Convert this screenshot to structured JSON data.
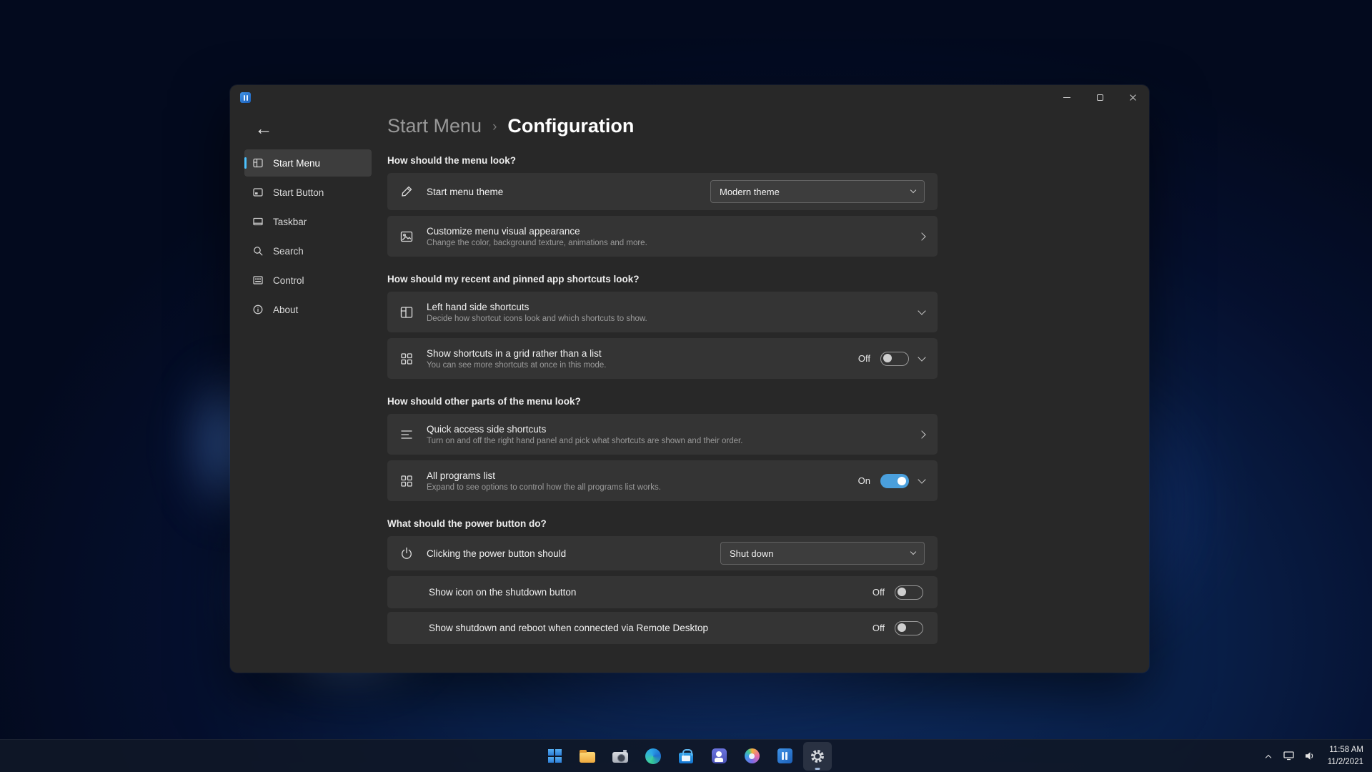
{
  "colors": {
    "accent": "#4cc2ff",
    "toggle_on": "#4a9fdc",
    "window_bg": "#282828",
    "card_bg": "#343434"
  },
  "icons": {
    "back_arrow": "←"
  },
  "breadcrumb": {
    "parent": "Start Menu",
    "separator": "›",
    "current": "Configuration"
  },
  "sidebar": {
    "items": [
      {
        "label": "Start Menu",
        "icon": "start-menu-icon",
        "active": true
      },
      {
        "label": "Start Button",
        "icon": "start-button-icon",
        "active": false
      },
      {
        "label": "Taskbar",
        "icon": "taskbar-icon",
        "active": false
      },
      {
        "label": "Search",
        "icon": "search-icon",
        "active": false
      },
      {
        "label": "Control",
        "icon": "control-icon",
        "active": false
      },
      {
        "label": "About",
        "icon": "about-icon",
        "active": false
      }
    ]
  },
  "headers": {
    "look": "How should the menu look?",
    "shortcuts": "How should my recent and pinned app shortcuts look?",
    "other": "How should other parts of the menu look?",
    "power": "What should the power button do?"
  },
  "rows": {
    "theme": {
      "icon": "pencil-icon",
      "title": "Start menu theme",
      "value": "Modern theme"
    },
    "customize": {
      "icon": "image-icon",
      "title": "Customize menu visual appearance",
      "subtitle": "Change the color, background texture, animations and more."
    },
    "leftside": {
      "icon": "layout-icon",
      "title": "Left hand side shortcuts",
      "subtitle": "Decide how shortcut icons look and which shortcuts to show."
    },
    "gridmode": {
      "icon": "grid-icon",
      "title": "Show shortcuts in a grid rather than a list",
      "subtitle": "You can see more shortcuts at once in this mode.",
      "state": "Off"
    },
    "quickaccess": {
      "icon": "list-icon",
      "title": "Quick access side shortcuts",
      "subtitle": "Turn on and off the right hand panel and pick what shortcuts are shown and their order."
    },
    "allprograms": {
      "icon": "grid-icon",
      "title": "All programs list",
      "subtitle": "Expand to see options to control how the all programs list works.",
      "state": "On"
    },
    "powerbutton": {
      "icon": "power-icon",
      "title": "Clicking the power button should",
      "value": "Shut down"
    },
    "shutdownicon": {
      "title": "Show icon on the shutdown button",
      "state": "Off"
    },
    "remotedesktop": {
      "title": "Show shutdown and reboot when connected via Remote Desktop",
      "state": "Off"
    }
  },
  "taskbar": {
    "icons": [
      "start",
      "file-explorer",
      "camera",
      "edge",
      "microsoft-store",
      "teams",
      "photos",
      "start11",
      "settings"
    ],
    "active_icon": "settings"
  },
  "tray": {
    "time": "11:58 AM",
    "date": "11/2/2021"
  }
}
